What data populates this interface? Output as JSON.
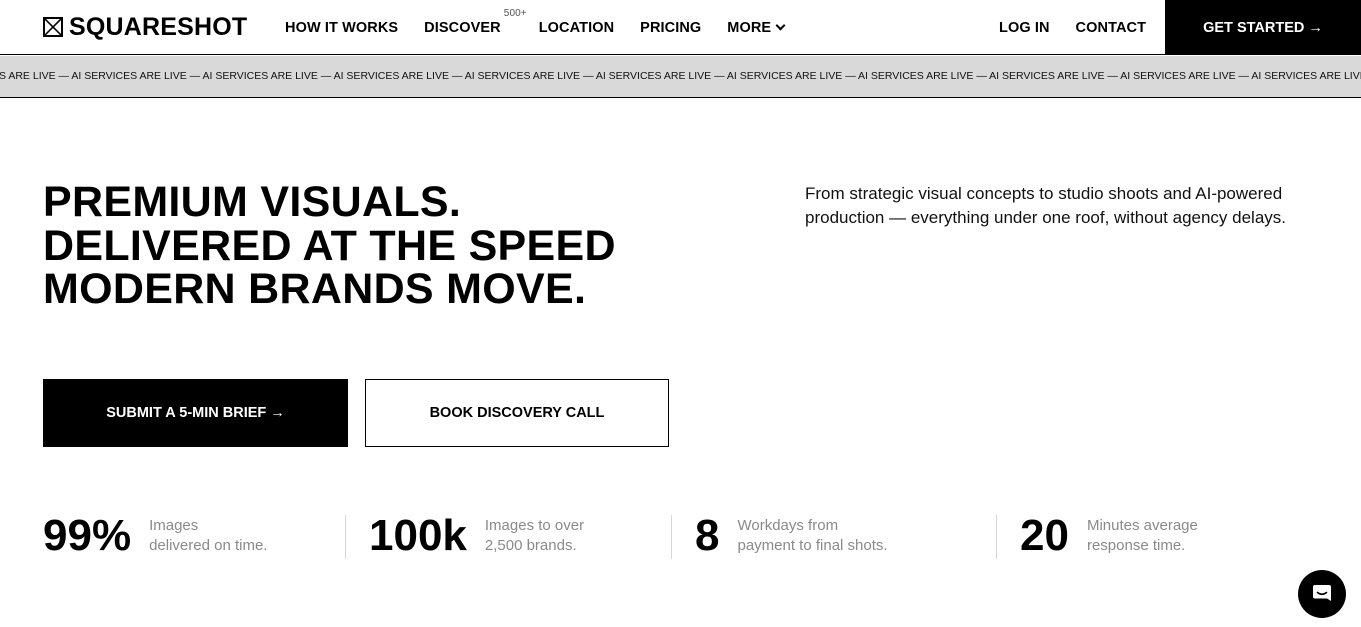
{
  "header": {
    "logo": "SQUARESHOT",
    "nav": [
      {
        "label": "HOW IT WORKS"
      },
      {
        "label": "DISCOVER",
        "badge": "500+"
      },
      {
        "label": "LOCATION"
      },
      {
        "label": "PRICING"
      },
      {
        "label": "MORE"
      }
    ],
    "login": "LOG IN",
    "contact": "CONTACT",
    "cta": "GET STARTED →"
  },
  "ticker": {
    "text": "ES ARE LIVE — AI SERVICES ARE LIVE — AI SERVICES ARE LIVE — AI SERVICES ARE LIVE — AI SERVICES ARE LIVE — AI SERVICES ARE LIVE — AI SERVICES ARE LIVE — AI SERVICES ARE LIVE — AI SERVICES ARE LIVE — AI SERVICES ARE LIVE — AI SERVICES ARE LIVE — AI SE"
  },
  "hero": {
    "headline": [
      "PREMIUM VISUALS.",
      "DELIVERED AT THE SPEED",
      "MODERN BRANDS MOVE."
    ],
    "intro": "From strategic visual concepts to studio shoots and AI-powered production — everything under one roof, without agency delays.",
    "primary_cta": "SUBMIT A 5-MIN BRIEF →",
    "secondary_cta": "BOOK DISCOVERY CALL"
  },
  "stats": [
    {
      "value": "99%",
      "line1": "Images",
      "line2": "delivered on time."
    },
    {
      "value": "100k",
      "line1": "Images to over",
      "line2": "2,500 brands."
    },
    {
      "value": "8",
      "line1": "Workdays from",
      "line2": "payment to final shots."
    },
    {
      "value": "20",
      "line1": "Minutes average",
      "line2": "response time."
    }
  ],
  "colors": {
    "accent": "#000000",
    "ticker_bg": "#d9d9d9",
    "muted": "#8a8a8a"
  },
  "chat": {
    "icon": "chat-icon"
  }
}
